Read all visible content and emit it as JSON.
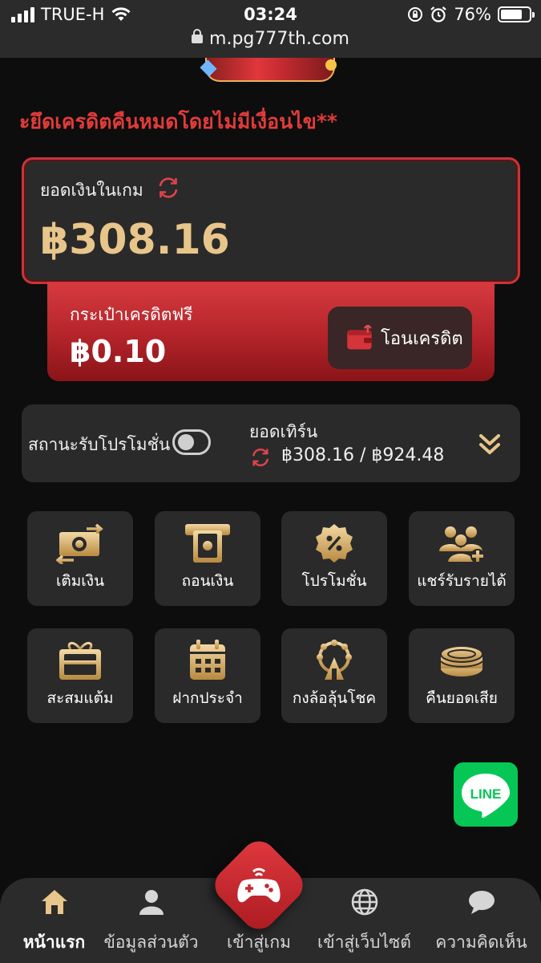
{
  "status_bar": {
    "carrier": "TRUE-H",
    "time": "03:24",
    "battery": "76%",
    "battery_level": 0.76,
    "url": "m.pg777th.com"
  },
  "marquee": {
    "text": "ะยึดเครดิตคืนหมดโดยไม่มีเงื่อนไข**"
  },
  "balance": {
    "label": "ยอดเงินในเกม",
    "amount": "฿308.16"
  },
  "free_wallet": {
    "label": "กระเป๋าเครดิตฟรี",
    "amount": "฿0.10",
    "transfer_label": "โอนเครดิต"
  },
  "promo": {
    "status_label": "สถานะรับโปรโมชั่น",
    "toggle_on": false,
    "turn_label": "ยอดเทิร์น",
    "turn_value": "฿308.16 / ฿924.48"
  },
  "menu": [
    {
      "label": "เติมเงิน",
      "icon": "deposit-icon"
    },
    {
      "label": "ถอนเงิน",
      "icon": "withdraw-icon"
    },
    {
      "label": "โปรโมชั่น",
      "icon": "promotion-icon"
    },
    {
      "label": "แชร์รับรายได้",
      "icon": "share-income-icon"
    },
    {
      "label": "สะสมแต้ม",
      "icon": "gift-icon"
    },
    {
      "label": "ฝากประจำ",
      "icon": "calendar-icon"
    },
    {
      "label": "กงล้อลุ้นโชค",
      "icon": "ferris-wheel-icon"
    },
    {
      "label": "คืนยอดเสีย",
      "icon": "coins-icon"
    }
  ],
  "line_button": {
    "label": "LINE"
  },
  "bottom_nav": {
    "home": "หน้าแรก",
    "profile": "ข้อมูลส่วนตัว",
    "game": "เข้าสู่เกม",
    "website": "เข้าสู่เว็บไซต์",
    "feedback": "ความคิดเห็น"
  },
  "colors": {
    "accent_red": "#d63a3f",
    "gold": "#e8c58a",
    "card": "#2a2a2a",
    "background": "#0d0d0d"
  }
}
